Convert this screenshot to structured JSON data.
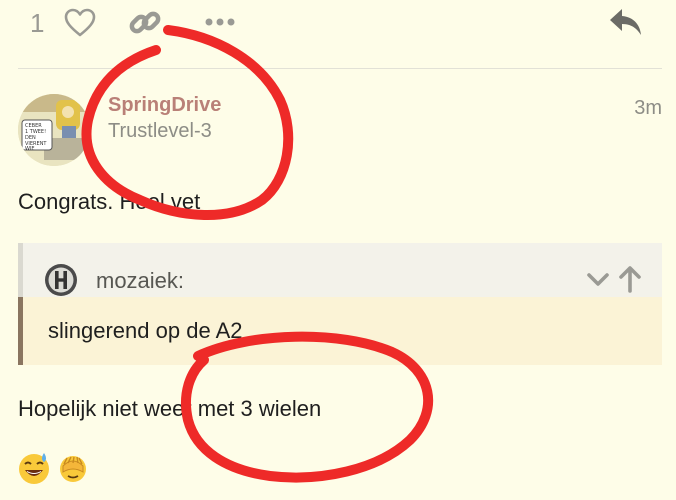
{
  "actions": {
    "like_count": "1",
    "heart_icon": "heart-icon",
    "link_icon": "link-icon",
    "more_icon": "more-icon",
    "reply_icon": "reply-icon"
  },
  "post": {
    "username": "SpringDrive",
    "user_title": "Trustlevel-3",
    "timestamp": "3m",
    "line1": "Congrats. Heel vet",
    "quote": {
      "author": "mozaiek:",
      "text": "slingerend op de A2"
    },
    "line2": "Hopelijk niet weer met 3 wielen",
    "avatar_comic_text": [
      "CEBER",
      "1 TWEE!",
      "DEN",
      "VIERENT",
      "WIE"
    ]
  },
  "emojis": [
    "sweat-smile-emoji",
    "see-no-evil-emoji"
  ],
  "colors": {
    "background": "#fefde8",
    "username": "#b98077",
    "annotation": "#ee2a28",
    "quote_border": "#8a7560"
  }
}
